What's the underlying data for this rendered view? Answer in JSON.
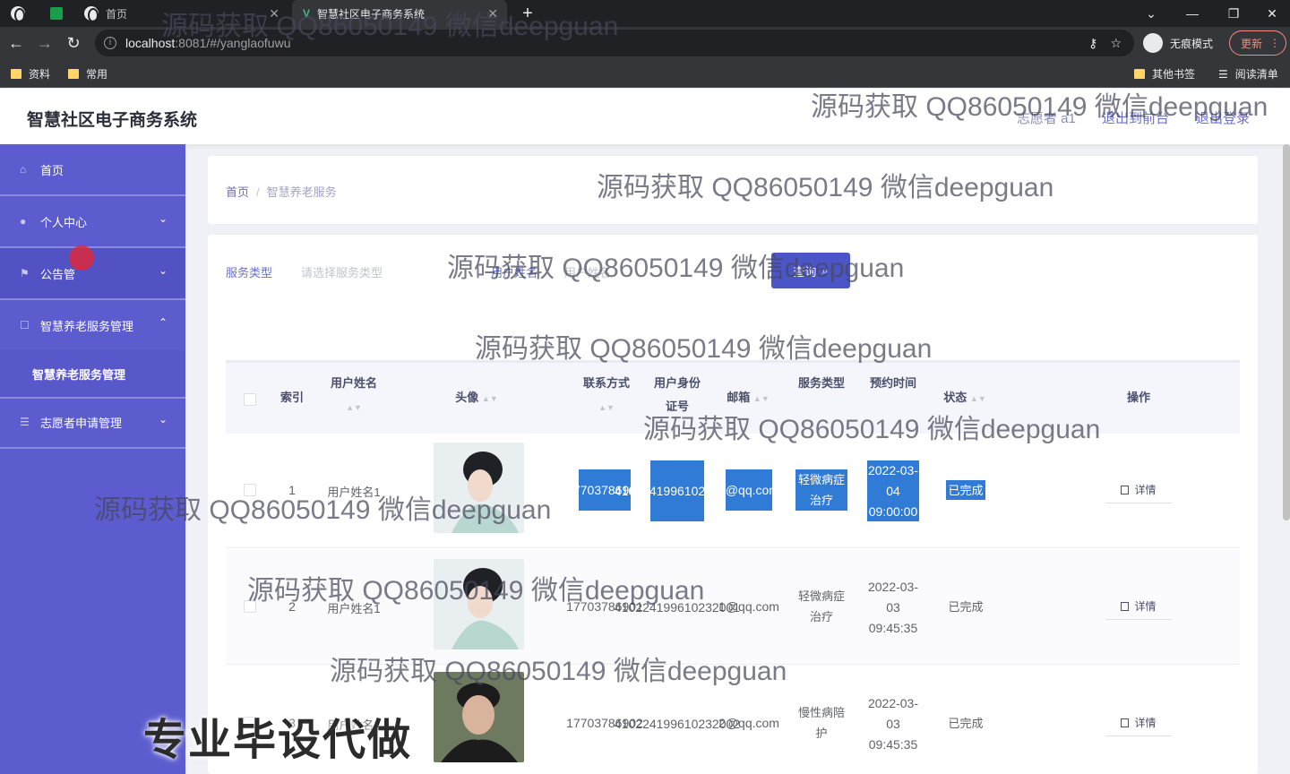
{
  "browser": {
    "tabs": [
      {
        "label": "首页"
      },
      {
        "label": "智慧社区电子商务系统"
      }
    ],
    "new_tab": "+",
    "url_host": "localhost",
    "url_path": ":8081/#/yanglaofuwu",
    "incognito_label": "无痕模式",
    "update_label": "更新",
    "bookmarks": [
      "资料",
      "常用"
    ],
    "other_bookmarks": "其他书签",
    "reading_list": "阅读清单"
  },
  "app": {
    "title": "智慧社区电子商务系统",
    "user": "志愿者 a1",
    "back_front": "退出到前台",
    "logout": "退出登录"
  },
  "sidebar": {
    "items": [
      {
        "label": "首页",
        "icon": "home-icon"
      },
      {
        "label": "个人中心",
        "icon": "user-icon"
      },
      {
        "label": "公告管",
        "icon": "flag-icon"
      },
      {
        "label": "智慧养老服务管理",
        "icon": "box-icon"
      },
      {
        "label": "志愿者申请管理",
        "icon": "list-icon"
      }
    ],
    "sub_item": "智慧养老服务管理"
  },
  "breadcrumb": {
    "home": "首页",
    "sep": "/",
    "current": "智慧养老服务"
  },
  "filters": {
    "service_type_label": "服务类型",
    "service_type_placeholder": "请选择服务类型",
    "user_name_label": "用户姓名",
    "user_name_placeholder": "用户姓名",
    "query_label": "查询"
  },
  "table": {
    "headers": {
      "index": "索引",
      "user_name": "用户姓名",
      "avatar": "头像",
      "contact": "联系方式",
      "id_card": "用户身份证号",
      "email": "邮箱",
      "service_type": "服务类型",
      "appointment": "预约时间",
      "status": "状态",
      "action": "操作"
    },
    "detail_label": "详情",
    "rows": [
      {
        "index": "1",
        "user_name": "用户姓名1",
        "contact": "17703786901",
        "id_card": "410224199610232001",
        "email": "1@qq.com",
        "service_type": "轻微病症治疗",
        "appointment": "2022-03-04 09:00:00",
        "status": "已完成"
      },
      {
        "index": "2",
        "user_name": "用户姓名1",
        "contact": "17703786901",
        "id_card": "410224199610232001",
        "email": "1@qq.com",
        "service_type": "轻微病症治疗",
        "appointment": "2022-03-03 09:45:35",
        "status": "已完成"
      },
      {
        "index": "3",
        "user_name": "用户姓名2",
        "contact": "17703786902",
        "id_card": "410224199610232002",
        "email": "2@qq.com",
        "service_type": "慢性病陪护",
        "appointment": "2022-03-03 09:45:35",
        "status": "已完成"
      }
    ]
  },
  "watermark": "源码获取 QQ86050149 微信deepguan",
  "banner": "专业毕设代做"
}
